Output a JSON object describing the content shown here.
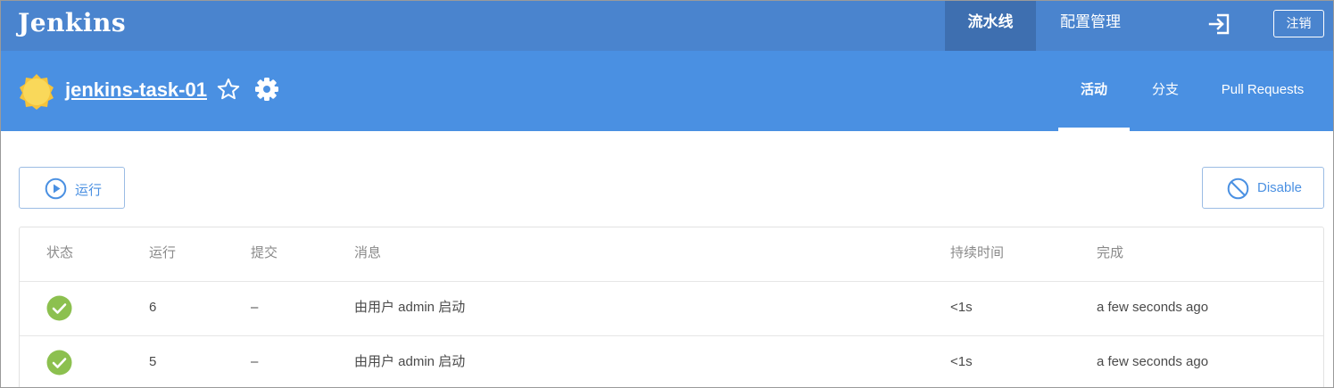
{
  "app": {
    "logo": "Jenkins",
    "nav": {
      "pipelines": "流水线",
      "administration": "配置管理"
    },
    "logout": "注销"
  },
  "job": {
    "name": "jenkins-task-01",
    "tabs": {
      "activity": "活动",
      "branches": "分支",
      "pull_requests": "Pull Requests"
    }
  },
  "actions": {
    "run": "运行",
    "disable": "Disable"
  },
  "table": {
    "headers": {
      "status": "状态",
      "run": "运行",
      "commit": "提交",
      "message": "消息",
      "duration": "持续时间",
      "completed": "完成"
    },
    "rows": [
      {
        "status": "success",
        "run": "6",
        "commit": "–",
        "message": "由用户 admin 启动",
        "duration": "<1s",
        "completed": "a few seconds ago"
      },
      {
        "status": "success",
        "run": "5",
        "commit": "–",
        "message": "由用户 admin 启动",
        "duration": "<1s",
        "completed": "a few seconds ago"
      }
    ]
  },
  "colors": {
    "topbar": "#4a84ce",
    "subheader": "#4a90e2",
    "active_nav": "#3e6fb0",
    "accent": "#4a90e2",
    "success": "#8cc04f"
  }
}
